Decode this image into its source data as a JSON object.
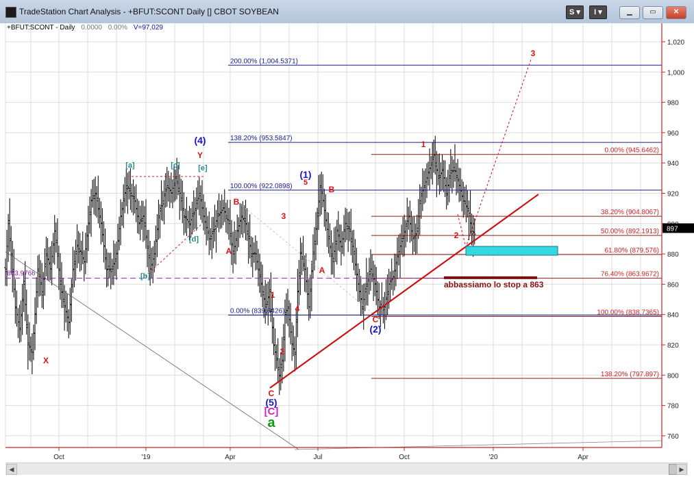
{
  "window": {
    "title": "TradeStation Chart Analysis - +BFUT:SCONT Daily [] CBOT SOYBEAN",
    "btn_s": "S ▾",
    "btn_i": "I ▾",
    "btn_min": "▁",
    "btn_max": "▭",
    "btn_close": "✕"
  },
  "chart_data": {
    "type": "ohlc-bar",
    "header": {
      "symbol": "+BFUT:SCONT - Daily",
      "change": "0.0000",
      "pct": "0.00%",
      "volume": "V=97,029"
    },
    "y_ticks": [
      "1,020",
      "1,000",
      "980",
      "960",
      "940",
      "920",
      "900",
      "880",
      "860",
      "840",
      "820",
      "800",
      "780",
      "760"
    ],
    "y_tick_values": [
      1020,
      1000,
      980,
      960,
      940,
      920,
      900,
      880,
      860,
      840,
      820,
      800,
      780,
      760
    ],
    "ylim": [
      751,
      1032
    ],
    "x_ticks": [
      "Oct",
      "'19",
      "Apr",
      "Jul",
      "Oct",
      "'20",
      "Apr"
    ],
    "last_price": "897",
    "fib_upper": [
      {
        "label": "200.00% (1,004.5371)",
        "value": 1004.5371
      },
      {
        "label": "138.20% (953.5847)",
        "value": 953.5847
      },
      {
        "label": "100.00% (922.0898)",
        "value": 922.0898
      },
      {
        "label": "0.00% (839.6426)",
        "value": 839.6426
      }
    ],
    "fib_lower": [
      {
        "label": "0.00% (945.6462)",
        "value": 945.6462
      },
      {
        "label": "38.20% (904.8067)",
        "value": 904.8067
      },
      {
        "label": "50.00% (892.1913)",
        "value": 892.1913
      },
      {
        "label": "61.80% (879.576)",
        "value": 879.576
      },
      {
        "label": "76.40% (863.9672)",
        "value": 863.9672
      },
      {
        "label": "100.00% (838.7365)",
        "value": 838.7365
      },
      {
        "label": "138.20% (797.897)",
        "value": 797.897
      }
    ],
    "purple_level": {
      "label": "863.9766",
      "value": 863.9766
    },
    "annotation": "abbassiamo lo stop a 863",
    "labels": [
      {
        "text": "X",
        "color": "#dd1111"
      },
      {
        "text": "[a]",
        "color": "#2a8a8a"
      },
      {
        "text": "[b]",
        "color": "#2a8a8a"
      },
      {
        "text": "[c]",
        "color": "#2a8a8a"
      },
      {
        "text": "[d]",
        "color": "#2a8a8a"
      },
      {
        "text": "[e]",
        "color": "#2a8a8a"
      },
      {
        "text": "(4)",
        "color": "#1515cc"
      },
      {
        "text": "Y",
        "color": "#dd1111"
      },
      {
        "text": "B",
        "color": "#dd1111"
      },
      {
        "text": "A",
        "color": "#dd1111"
      },
      {
        "text": "3",
        "color": "#dd1111"
      },
      {
        "text": "1",
        "color": "#dd1111"
      },
      {
        "text": "4",
        "color": "#dd1111"
      },
      {
        "text": "2",
        "color": "#dd1111"
      },
      {
        "text": "C",
        "color": "#dd1111"
      },
      {
        "text": "(5)",
        "color": "#1515cc"
      },
      {
        "text": "[C]",
        "color": "#cc22cc"
      },
      {
        "text": "a",
        "color": "#119911"
      },
      {
        "text": "(1)",
        "color": "#1515cc"
      },
      {
        "text": "5",
        "color": "#dd1111"
      },
      {
        "text": "B",
        "color": "#dd1111"
      },
      {
        "text": "A",
        "color": "#dd1111"
      },
      {
        "text": "C",
        "color": "#dd1111"
      },
      {
        "text": "(2)",
        "color": "#1515cc"
      },
      {
        "text": "1",
        "color": "#dd1111"
      },
      {
        "text": "2",
        "color": "#dd1111"
      },
      {
        "text": "3",
        "color": "#dd1111"
      }
    ],
    "price_path": [
      [
        870,
        0
      ],
      [
        900,
        4
      ],
      [
        880,
        8
      ],
      [
        845,
        14
      ],
      [
        830,
        20
      ],
      [
        860,
        26
      ],
      [
        820,
        32
      ],
      [
        815,
        38
      ],
      [
        840,
        42
      ],
      [
        870,
        46
      ],
      [
        855,
        52
      ],
      [
        880,
        58
      ],
      [
        870,
        64
      ],
      [
        895,
        70
      ],
      [
        880,
        74
      ],
      [
        860,
        78
      ],
      [
        845,
        84
      ],
      [
        835,
        90
      ],
      [
        870,
        96
      ],
      [
        885,
        102
      ],
      [
        880,
        108
      ],
      [
        875,
        112
      ],
      [
        900,
        118
      ],
      [
        915,
        122
      ],
      [
        920,
        128
      ],
      [
        900,
        136
      ],
      [
        870,
        144
      ],
      [
        870,
        152
      ],
      [
        880,
        158
      ],
      [
        905,
        164
      ],
      [
        925,
        172
      ],
      [
        920,
        178
      ],
      [
        915,
        184
      ],
      [
        900,
        190
      ],
      [
        905,
        196
      ],
      [
        885,
        202
      ],
      [
        870,
        206
      ],
      [
        880,
        212
      ],
      [
        905,
        218
      ],
      [
        915,
        224
      ],
      [
        925,
        230
      ],
      [
        920,
        236
      ],
      [
        930,
        242
      ],
      [
        920,
        248
      ],
      [
        905,
        254
      ],
      [
        900,
        262
      ],
      [
        910,
        270
      ],
      [
        920,
        276
      ],
      [
        905,
        282
      ],
      [
        890,
        290
      ],
      [
        895,
        296
      ],
      [
        905,
        302
      ],
      [
        910,
        310
      ],
      [
        900,
        318
      ],
      [
        880,
        324
      ],
      [
        895,
        330
      ],
      [
        905,
        336
      ],
      [
        900,
        342
      ],
      [
        880,
        350
      ],
      [
        880,
        356
      ],
      [
        860,
        364
      ],
      [
        845,
        370
      ],
      [
        855,
        376
      ],
      [
        820,
        382
      ],
      [
        800,
        390
      ],
      [
        810,
        394
      ],
      [
        840,
        398
      ],
      [
        845,
        402
      ],
      [
        820,
        408
      ],
      [
        815,
        412
      ],
      [
        855,
        416
      ],
      [
        880,
        420
      ],
      [
        870,
        426
      ],
      [
        845,
        432
      ],
      [
        880,
        438
      ],
      [
        905,
        444
      ],
      [
        925,
        448
      ],
      [
        915,
        452
      ],
      [
        890,
        460
      ],
      [
        875,
        466
      ],
      [
        895,
        472
      ],
      [
        885,
        478
      ],
      [
        900,
        484
      ],
      [
        895,
        490
      ],
      [
        880,
        496
      ],
      [
        860,
        502
      ],
      [
        845,
        508
      ],
      [
        860,
        514
      ],
      [
        870,
        520
      ],
      [
        860,
        526
      ],
      [
        845,
        532
      ],
      [
        845,
        540
      ],
      [
        860,
        546
      ],
      [
        865,
        552
      ],
      [
        878,
        558
      ],
      [
        885,
        562
      ],
      [
        895,
        568
      ],
      [
        905,
        574
      ],
      [
        890,
        580
      ],
      [
        895,
        586
      ],
      [
        915,
        590
      ],
      [
        925,
        596
      ],
      [
        930,
        600
      ],
      [
        940,
        606
      ],
      [
        945,
        610
      ],
      [
        930,
        616
      ],
      [
        935,
        622
      ],
      [
        920,
        628
      ],
      [
        935,
        634
      ],
      [
        935,
        640
      ],
      [
        925,
        646
      ],
      [
        915,
        652
      ],
      [
        910,
        658
      ],
      [
        895,
        664
      ],
      [
        893,
        668
      ]
    ]
  }
}
